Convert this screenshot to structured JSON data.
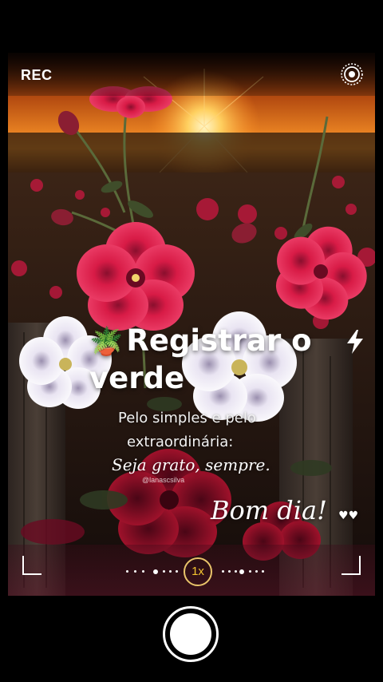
{
  "camera": {
    "rec_label": "REC",
    "zoom_label": "1x",
    "icons": {
      "live": "live-photo-icon",
      "flash": "flash-icon",
      "plant": "potted-plant-emoji"
    }
  },
  "image_text": {
    "headline_emoji": "🪴",
    "headline": "Registrar o verde",
    "line1": "Pelo simples e pelo",
    "line2": "extraordinária:",
    "script1": "Seja grato, sempre.",
    "watermark": "@lanascsilva",
    "script2": "Bom dia!",
    "hearts": "♥♥"
  },
  "colors": {
    "accent_zoom": "#f4c430",
    "flower_red": "#d81b46",
    "sky_orange": "#ff8a1f"
  }
}
